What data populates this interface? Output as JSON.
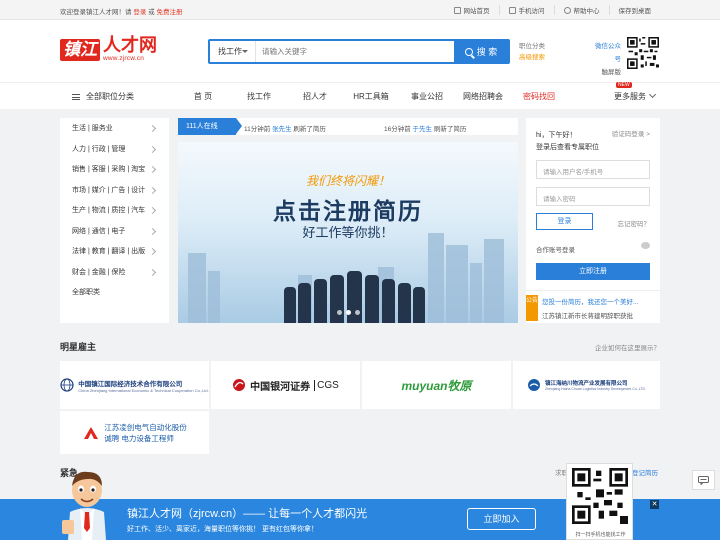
{
  "topbar": {
    "welcome_prefix": "欢迎登录镇江人才网！请",
    "login": "登录",
    "or": "或",
    "register": "免费注册",
    "links": [
      "网站首页",
      "手机访问",
      "帮助中心",
      "保存到桌面"
    ]
  },
  "logo": {
    "mark": "镇江",
    "name": "人才网",
    "url": "www.zjrcw.cn"
  },
  "search": {
    "select_label": "找工作",
    "placeholder": "请输入关键字",
    "button_label": "搜 索"
  },
  "hot_links": {
    "first": "职位分类",
    "second": "高级搜索"
  },
  "wechat": {
    "line1": "微信公众号",
    "line2": "触屏版"
  },
  "nav": {
    "all_categories": "全部职位分类",
    "items": [
      "首 页",
      "找工作",
      "招人才",
      "HR工具箱",
      "事业公招",
      "网络招聘会",
      "密码找回"
    ],
    "more": "更多服务",
    "new_tag": "NEW"
  },
  "sidebar": {
    "items": [
      "生活 | 服务业",
      "人力 | 行政 | 管理",
      "销售 | 客服 | 采购 | 淘宝",
      "市场 | 媒介 | 广告 | 设计",
      "生产 | 物流 | 质控 | 汽车",
      "网络 | 通信 | 电子",
      "法律 | 教育 | 翻译 | 出版",
      "财会 | 金融 | 保险",
      "全部职类"
    ]
  },
  "ticker": {
    "online": "111人在线",
    "m1_time": "11分钟前",
    "m1_name": "张先生",
    "m1_action": "刷新了简历",
    "m2_time": "16分钟前",
    "m2_name": "于先生",
    "m2_action": "刷新了简历"
  },
  "banner": {
    "line1": "我们终将闪耀！",
    "line2": "点击注册简历",
    "line3": "好工作等你挑！"
  },
  "login": {
    "greeting": "hi，下午好！",
    "code_login": "验证码登录 >",
    "subtitle": "登录后查看专属职位",
    "user_placeholder": "请输入用户名/手机号",
    "pwd_placeholder": "请输入密码",
    "login_button": "登录",
    "forgot": "忘记密码？",
    "partner_login": "合作账号登录",
    "register_button": "立即注册",
    "notice_tag": "公告",
    "notice1": "您投一份简历，我还您一个美好...",
    "notice2": "江苏镇江新市长蒋建明辞职获批"
  },
  "employers": {
    "title": "明星雇主",
    "ad_link": "企业如何在这里展示？",
    "items": [
      {
        "cn": "中国镇江国际经济技术合作有限公司",
        "en": "China Zhenjiang International Economic & Technical Cooperation Co.,Ltd."
      },
      {
        "cn": "中国银河证券",
        "en": "CGS"
      },
      {
        "cn": "muyuan牧原",
        "en": ""
      },
      {
        "cn": "镇江海纳川物流产业发展有限公司",
        "en": "Zhenjiang Haina Chuan Logistics Industry Development Co.,LTD."
      },
      {
        "cn": "江苏凌创电气自动化股份",
        "en": "诚聘 电力设备工程师"
      }
    ]
  },
  "urgent": {
    "title": "紧急",
    "right1": "求职",
    "right2": "登记简历"
  },
  "bottom_bar": {
    "title": "镇江人才网（zjrcw.cn）—— 让每一个人才都闪光",
    "subtitle": "好工作、活少、离家近，海量职位等你挑！ 更有红包等你拿！",
    "join_button": "立即加入",
    "close": "✕"
  },
  "float_qr": {
    "caption": "扫一扫手机也能找工作"
  },
  "colors": {
    "brand_red": "#e0281f",
    "brand_blue": "#2a7fd9",
    "accent_orange": "#f39800",
    "bottom_blue": "#2a86de"
  }
}
